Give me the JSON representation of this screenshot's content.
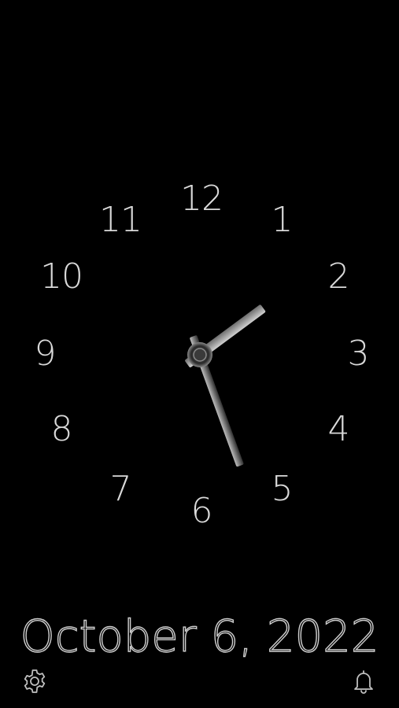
{
  "clock": {
    "numerals": [
      "12",
      "1",
      "2",
      "3",
      "4",
      "5",
      "6",
      "7",
      "8",
      "9",
      "10",
      "11"
    ],
    "time": {
      "hour": 1,
      "minute": 27
    },
    "colors": {
      "numerals": "#d9d9d9",
      "hands": "#cfcfcf",
      "background": "#000000"
    }
  },
  "date_text": "October 6, 2022",
  "toolbar": {
    "settings_icon": "gear-icon",
    "alarm_icon": "bell-icon"
  }
}
